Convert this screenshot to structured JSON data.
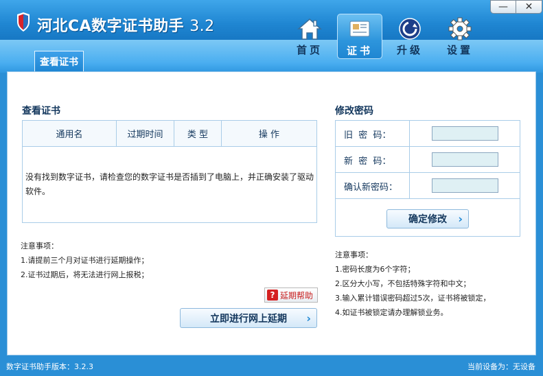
{
  "app": {
    "title": "河北CA数字证书助手",
    "version": "3.2"
  },
  "window_controls": {
    "minimize": "—",
    "close": "✕"
  },
  "nav": [
    {
      "label": "首页",
      "icon": "home-icon"
    },
    {
      "label": "证书",
      "icon": "certificate-icon",
      "active": true
    },
    {
      "label": "升级",
      "icon": "upgrade-icon"
    },
    {
      "label": "设置",
      "icon": "gear-icon"
    }
  ],
  "tab": {
    "label": "查看证书"
  },
  "cert": {
    "section_title": "查看证书",
    "columns": [
      "通用名",
      "过期时间",
      "类 型",
      "操 作"
    ],
    "empty_message": "没有找到数字证书，请检查您的数字证书是否插到了电脑上，并正确安装了驱动软件。",
    "notes_title": "注意事项：",
    "notes": [
      "1.请提前三个月对证书进行延期操作；",
      "2.证书过期后，将无法进行网上报税；"
    ],
    "help_button": "延期帮助",
    "extend_button": "立即进行网上延期"
  },
  "password": {
    "section_title": "修改密码",
    "fields": [
      {
        "label": "旧  密  码：",
        "value": ""
      },
      {
        "label": "新  密  码：",
        "value": ""
      },
      {
        "label": "确认新密码：",
        "value": ""
      }
    ],
    "confirm_button": "确定修改",
    "notes_title": "注意事项：",
    "notes": [
      "1.密码长度为6个字符；",
      "2.区分大小写，不包括特殊字符和中文；",
      "3.输入累计错误密码超过5次，证书将被锁定，",
      "4.如证书被锁定请办理解锁业务。"
    ]
  },
  "status": {
    "version_text": "数字证书助手版本：3.2.3",
    "device_text": "当前设备为：无设备"
  },
  "colors": {
    "title_bar": "#1f86d2",
    "accent_blue": "#2e97e0",
    "heading_text": "#12365c",
    "help_red": "#d42020",
    "input_bg": "#dff0f4"
  }
}
